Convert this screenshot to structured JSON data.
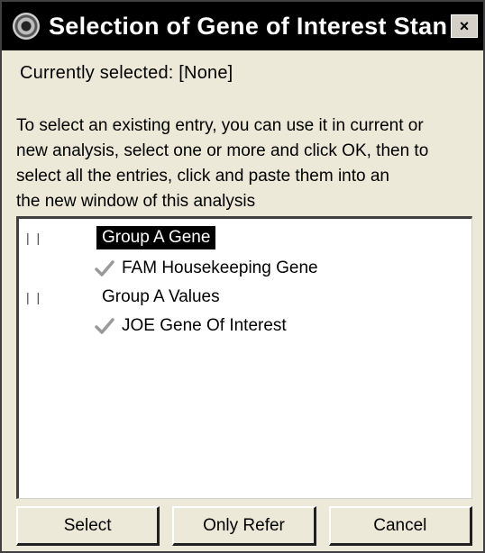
{
  "window": {
    "title": "Selection of Gene of Interest Standar...",
    "close_label": "×"
  },
  "status_line": "Currently selected: [None]",
  "instructions": [
    "To select an existing entry, you can use it in current or",
    "new analysis, select one or more and click OK, then to",
    "select all the entries, click and paste them into an",
    "the new window of this analysis"
  ],
  "tree": {
    "groups": [
      {
        "expander": "|  |",
        "label": "Group A Gene",
        "selected": true,
        "children": [
          {
            "icon": "check-icon",
            "label": "FAM Housekeeping Gene"
          }
        ]
      },
      {
        "expander": "|  |",
        "label": "Group A Values",
        "selected": false,
        "children": [
          {
            "icon": "check-icon",
            "label": "JOE Gene Of Interest"
          }
        ]
      }
    ]
  },
  "buttons": {
    "select_label": "Select",
    "only_label": "Only Refer",
    "cancel_label": "Cancel"
  },
  "colors": {
    "titlebar": "#000000",
    "dialog_bg": "#ece9d8",
    "check": "#9a9a9a"
  }
}
